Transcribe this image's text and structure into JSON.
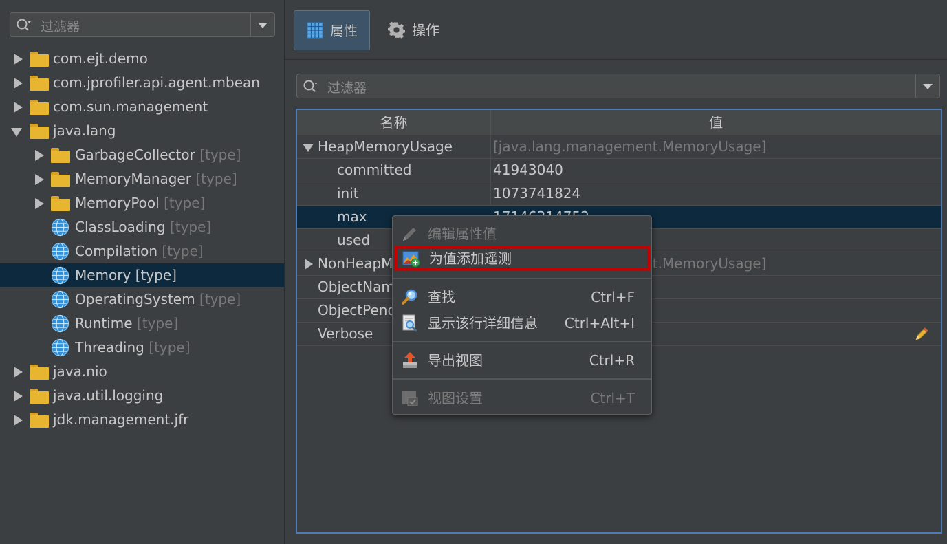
{
  "left_panel": {
    "filter_placeholder": "过滤器",
    "tree": [
      {
        "label": "com.ejt.demo",
        "suffix": "",
        "level": 0,
        "icon": "folder-icon",
        "arrow": "collapsed"
      },
      {
        "label": "com.jprofiler.api.agent.mbean",
        "suffix": "",
        "level": 0,
        "icon": "folder-icon",
        "arrow": "collapsed"
      },
      {
        "label": "com.sun.management",
        "suffix": "",
        "level": 0,
        "icon": "folder-icon",
        "arrow": "collapsed"
      },
      {
        "label": "java.lang",
        "suffix": "",
        "level": 0,
        "icon": "folder-icon",
        "arrow": "expanded"
      },
      {
        "label": "GarbageCollector",
        "suffix": "[type]",
        "level": 1,
        "icon": "folder-icon",
        "arrow": "collapsed"
      },
      {
        "label": "MemoryManager",
        "suffix": "[type]",
        "level": 1,
        "icon": "folder-icon",
        "arrow": "collapsed"
      },
      {
        "label": "MemoryPool",
        "suffix": "[type]",
        "level": 1,
        "icon": "folder-icon",
        "arrow": "collapsed"
      },
      {
        "label": "ClassLoading",
        "suffix": "[type]",
        "level": 1,
        "icon": "globe-icon",
        "arrow": "none"
      },
      {
        "label": "Compilation",
        "suffix": "[type]",
        "level": 1,
        "icon": "globe-icon",
        "arrow": "none"
      },
      {
        "label": "Memory",
        "suffix": "[type]",
        "level": 1,
        "icon": "globe-icon",
        "arrow": "none",
        "selected": true
      },
      {
        "label": "OperatingSystem",
        "suffix": "[type]",
        "level": 1,
        "icon": "globe-icon",
        "arrow": "none"
      },
      {
        "label": "Runtime",
        "suffix": "[type]",
        "level": 1,
        "icon": "globe-icon",
        "arrow": "none"
      },
      {
        "label": "Threading",
        "suffix": "[type]",
        "level": 1,
        "icon": "globe-icon",
        "arrow": "none"
      },
      {
        "label": "java.nio",
        "suffix": "",
        "level": 0,
        "icon": "folder-icon",
        "arrow": "collapsed"
      },
      {
        "label": "java.util.logging",
        "suffix": "",
        "level": 0,
        "icon": "folder-icon",
        "arrow": "collapsed"
      },
      {
        "label": "jdk.management.jfr",
        "suffix": "",
        "level": 0,
        "icon": "folder-icon",
        "arrow": "collapsed"
      }
    ]
  },
  "tabs": [
    {
      "label": "属性",
      "icon": "table-icon",
      "active": true
    },
    {
      "label": "操作",
      "icon": "gear-icon",
      "active": false
    }
  ],
  "right_filter_placeholder": "过滤器",
  "grid": {
    "headers": [
      "名称",
      "值"
    ],
    "rows": [
      {
        "name": "HeapMemoryUsage",
        "value": "[java.lang.management.MemoryUsage]",
        "indent": 0,
        "arrow": "expanded",
        "value_gray": true
      },
      {
        "name": "committed",
        "value": "41943040",
        "indent": 1,
        "arrow": "none"
      },
      {
        "name": "init",
        "value": "1073741824",
        "indent": 1,
        "arrow": "none"
      },
      {
        "name": "max",
        "value": "17146314752",
        "indent": 1,
        "arrow": "none",
        "selected": true
      },
      {
        "name": "used",
        "value": "",
        "indent": 1,
        "arrow": "none"
      },
      {
        "name": "NonHeapMemoryUsage",
        "value": "[java.lang.management.MemoryUsage]",
        "indent": 0,
        "arrow": "collapsed",
        "value_gray": true
      },
      {
        "name": "ObjectName",
        "value": "",
        "indent": 0,
        "arrow": "none"
      },
      {
        "name": "ObjectPendingFinalizationCount",
        "value": "",
        "indent": 0,
        "arrow": "none"
      },
      {
        "name": "Verbose",
        "value": "",
        "indent": 0,
        "arrow": "none",
        "editable": true
      }
    ]
  },
  "context_menu": {
    "items": [
      {
        "label": "编辑属性值",
        "shortcut": "",
        "icon": "edit-pen-icon",
        "disabled": true
      },
      {
        "label": "为值添加遥测",
        "shortcut": "",
        "icon": "add-telemetry-icon",
        "highlighted": true
      },
      {
        "label": "查找",
        "shortcut": "Ctrl+F",
        "icon": "find-magnifier-icon"
      },
      {
        "label": "显示该行详细信息",
        "shortcut": "Ctrl+Alt+I",
        "icon": "details-icon"
      },
      {
        "label": "导出视图",
        "shortcut": "Ctrl+R",
        "icon": "export-icon"
      },
      {
        "label": "视图设置",
        "shortcut": "Ctrl+T",
        "icon": "view-settings-icon",
        "disabled": true
      }
    ]
  },
  "colors": {
    "background": "#3c3f41",
    "selection": "#0d293e",
    "folder": "#e8b530",
    "globe": "#2f8fd8",
    "focus_border": "#4b7bb8",
    "highlight_border": "#c40000"
  }
}
